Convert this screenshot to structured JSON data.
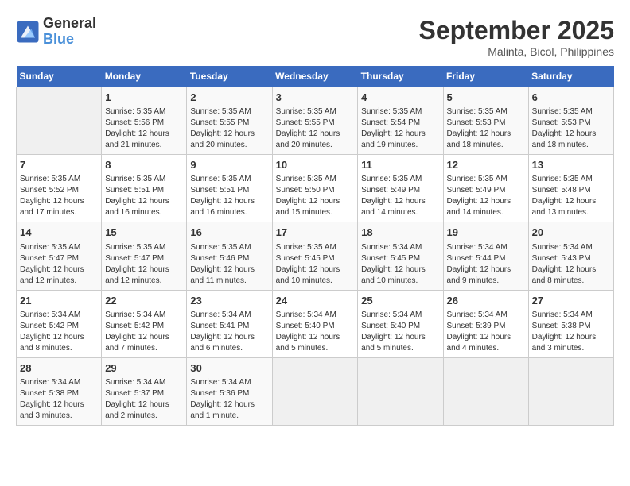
{
  "header": {
    "logo_line1": "General",
    "logo_line2": "Blue",
    "month": "September 2025",
    "location": "Malinta, Bicol, Philippines"
  },
  "days_of_week": [
    "Sunday",
    "Monday",
    "Tuesday",
    "Wednesday",
    "Thursday",
    "Friday",
    "Saturday"
  ],
  "weeks": [
    [
      {
        "day": "",
        "info": ""
      },
      {
        "day": "1",
        "info": "Sunrise: 5:35 AM\nSunset: 5:56 PM\nDaylight: 12 hours\nand 21 minutes."
      },
      {
        "day": "2",
        "info": "Sunrise: 5:35 AM\nSunset: 5:55 PM\nDaylight: 12 hours\nand 20 minutes."
      },
      {
        "day": "3",
        "info": "Sunrise: 5:35 AM\nSunset: 5:55 PM\nDaylight: 12 hours\nand 20 minutes."
      },
      {
        "day": "4",
        "info": "Sunrise: 5:35 AM\nSunset: 5:54 PM\nDaylight: 12 hours\nand 19 minutes."
      },
      {
        "day": "5",
        "info": "Sunrise: 5:35 AM\nSunset: 5:53 PM\nDaylight: 12 hours\nand 18 minutes."
      },
      {
        "day": "6",
        "info": "Sunrise: 5:35 AM\nSunset: 5:53 PM\nDaylight: 12 hours\nand 18 minutes."
      }
    ],
    [
      {
        "day": "7",
        "info": "Sunrise: 5:35 AM\nSunset: 5:52 PM\nDaylight: 12 hours\nand 17 minutes."
      },
      {
        "day": "8",
        "info": "Sunrise: 5:35 AM\nSunset: 5:51 PM\nDaylight: 12 hours\nand 16 minutes."
      },
      {
        "day": "9",
        "info": "Sunrise: 5:35 AM\nSunset: 5:51 PM\nDaylight: 12 hours\nand 16 minutes."
      },
      {
        "day": "10",
        "info": "Sunrise: 5:35 AM\nSunset: 5:50 PM\nDaylight: 12 hours\nand 15 minutes."
      },
      {
        "day": "11",
        "info": "Sunrise: 5:35 AM\nSunset: 5:49 PM\nDaylight: 12 hours\nand 14 minutes."
      },
      {
        "day": "12",
        "info": "Sunrise: 5:35 AM\nSunset: 5:49 PM\nDaylight: 12 hours\nand 14 minutes."
      },
      {
        "day": "13",
        "info": "Sunrise: 5:35 AM\nSunset: 5:48 PM\nDaylight: 12 hours\nand 13 minutes."
      }
    ],
    [
      {
        "day": "14",
        "info": "Sunrise: 5:35 AM\nSunset: 5:47 PM\nDaylight: 12 hours\nand 12 minutes."
      },
      {
        "day": "15",
        "info": "Sunrise: 5:35 AM\nSunset: 5:47 PM\nDaylight: 12 hours\nand 12 minutes."
      },
      {
        "day": "16",
        "info": "Sunrise: 5:35 AM\nSunset: 5:46 PM\nDaylight: 12 hours\nand 11 minutes."
      },
      {
        "day": "17",
        "info": "Sunrise: 5:35 AM\nSunset: 5:45 PM\nDaylight: 12 hours\nand 10 minutes."
      },
      {
        "day": "18",
        "info": "Sunrise: 5:34 AM\nSunset: 5:45 PM\nDaylight: 12 hours\nand 10 minutes."
      },
      {
        "day": "19",
        "info": "Sunrise: 5:34 AM\nSunset: 5:44 PM\nDaylight: 12 hours\nand 9 minutes."
      },
      {
        "day": "20",
        "info": "Sunrise: 5:34 AM\nSunset: 5:43 PM\nDaylight: 12 hours\nand 8 minutes."
      }
    ],
    [
      {
        "day": "21",
        "info": "Sunrise: 5:34 AM\nSunset: 5:42 PM\nDaylight: 12 hours\nand 8 minutes."
      },
      {
        "day": "22",
        "info": "Sunrise: 5:34 AM\nSunset: 5:42 PM\nDaylight: 12 hours\nand 7 minutes."
      },
      {
        "day": "23",
        "info": "Sunrise: 5:34 AM\nSunset: 5:41 PM\nDaylight: 12 hours\nand 6 minutes."
      },
      {
        "day": "24",
        "info": "Sunrise: 5:34 AM\nSunset: 5:40 PM\nDaylight: 12 hours\nand 5 minutes."
      },
      {
        "day": "25",
        "info": "Sunrise: 5:34 AM\nSunset: 5:40 PM\nDaylight: 12 hours\nand 5 minutes."
      },
      {
        "day": "26",
        "info": "Sunrise: 5:34 AM\nSunset: 5:39 PM\nDaylight: 12 hours\nand 4 minutes."
      },
      {
        "day": "27",
        "info": "Sunrise: 5:34 AM\nSunset: 5:38 PM\nDaylight: 12 hours\nand 3 minutes."
      }
    ],
    [
      {
        "day": "28",
        "info": "Sunrise: 5:34 AM\nSunset: 5:38 PM\nDaylight: 12 hours\nand 3 minutes."
      },
      {
        "day": "29",
        "info": "Sunrise: 5:34 AM\nSunset: 5:37 PM\nDaylight: 12 hours\nand 2 minutes."
      },
      {
        "day": "30",
        "info": "Sunrise: 5:34 AM\nSunset: 5:36 PM\nDaylight: 12 hours\nand 1 minute."
      },
      {
        "day": "",
        "info": ""
      },
      {
        "day": "",
        "info": ""
      },
      {
        "day": "",
        "info": ""
      },
      {
        "day": "",
        "info": ""
      }
    ]
  ]
}
